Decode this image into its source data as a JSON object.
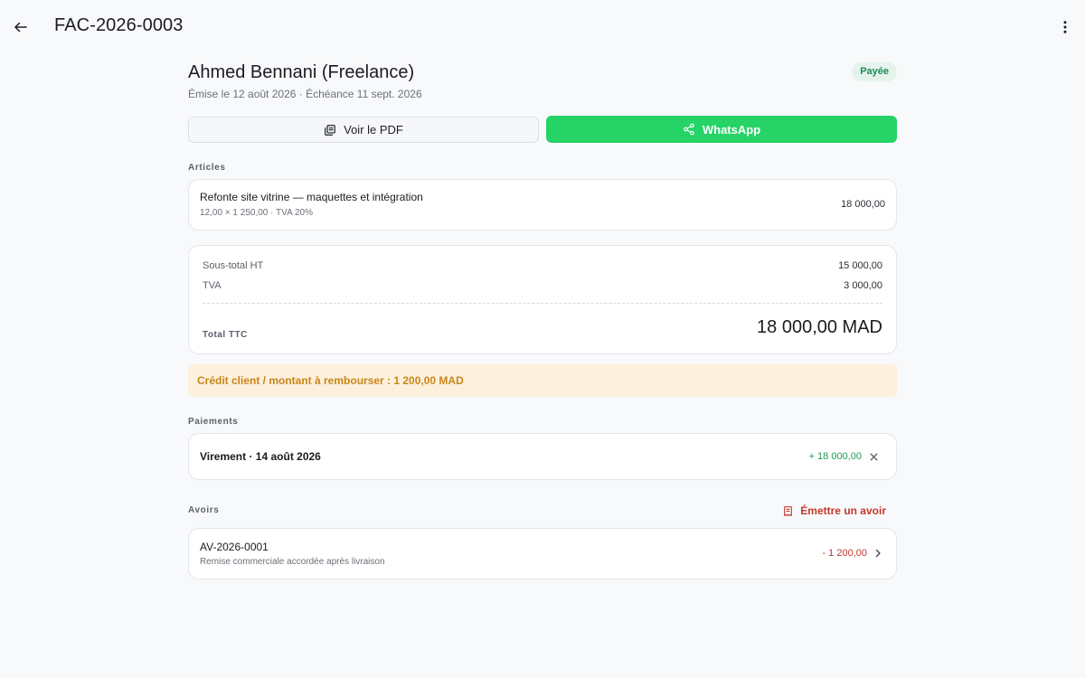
{
  "header": {
    "title": "FAC-2026-0003"
  },
  "invoice": {
    "client": "Ahmed Bennani (Freelance)",
    "dates": "Émise le 12 août 2026 · Échéance 11 sept. 2026",
    "status": "Payée"
  },
  "actions": {
    "pdf_label": "Voir le PDF",
    "whatsapp_label": "WhatsApp"
  },
  "articles": {
    "label": "Articles",
    "items": [
      {
        "title": "Refonte site vitrine — maquettes et intégration",
        "detail": "12,00 × 1 250,00 · TVA 20%",
        "amount": "18 000,00"
      }
    ]
  },
  "totals": {
    "subtotal_label": "Sous-total HT",
    "subtotal_value": "15 000,00",
    "tva_label": "TVA",
    "tva_value": "3 000,00",
    "ttc_label": "Total TTC",
    "ttc_value": "18 000,00 MAD"
  },
  "credit_notice": "Crédit client / montant à rembourser : 1 200,00 MAD",
  "payments": {
    "label": "Paiements",
    "items": [
      {
        "label": "Virement · 14 août 2026",
        "amount": "+ 18 000,00"
      }
    ]
  },
  "avoirs": {
    "label": "Avoirs",
    "emit_label": "Émettre un avoir",
    "items": [
      {
        "number": "AV-2026-0001",
        "description": "Remise commerciale accordée après livraison",
        "amount": "- 1 200,00"
      }
    ]
  },
  "colors": {
    "accent_green": "#25d366",
    "status_paid": "#1f8a55",
    "credit_warning": "#c8861a",
    "danger": "#c0392b"
  },
  "icons": {
    "back": "arrow-left-icon",
    "more": "more-vertical-icon",
    "pdf": "pdf-document-icon",
    "share": "share-icon",
    "close": "close-icon",
    "receipt": "receipt-icon",
    "chevron": "chevron-right-icon"
  }
}
